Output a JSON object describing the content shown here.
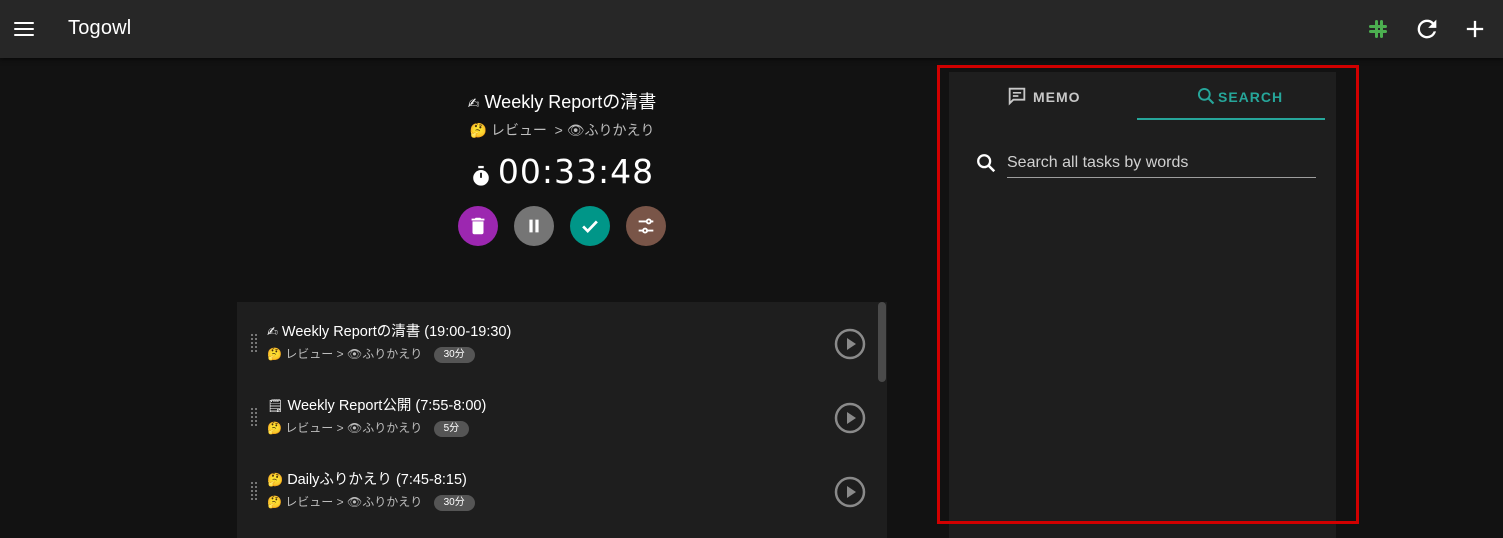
{
  "app": {
    "title": "Togowl"
  },
  "current_task": {
    "emoji": "✍",
    "title": "Weekly Reportの清書",
    "project_emoji": "🤔",
    "project": "レビュー",
    "separator": ">",
    "sub_emoji": "👁",
    "subproject": "ふりかえり",
    "timer": "00:33:48"
  },
  "controls": {
    "delete_color": "#9c27b0",
    "pause_color": "#757575",
    "complete_color": "#009688",
    "adjust_color": "#795548"
  },
  "tasks": [
    {
      "emoji": "✍",
      "title": "Weekly Reportの清書 (19:00-19:30)",
      "project_emoji": "🤔",
      "project": "レビュー",
      "separator": ">",
      "sub_emoji": "👁",
      "subproject": "ふりかえり",
      "estimate": "30分"
    },
    {
      "emoji": "🗒",
      "title": "Weekly Report公開 (7:55-8:00)",
      "project_emoji": "🤔",
      "project": "レビュー",
      "separator": ">",
      "sub_emoji": "👁",
      "subproject": "ふりかえり",
      "estimate": "5分"
    },
    {
      "emoji": "🤔",
      "title": "Dailyふりかえり (7:45-8:15)",
      "project_emoji": "🤔",
      "project": "レビュー",
      "separator": ">",
      "sub_emoji": "👁",
      "subproject": "ふりかえり",
      "estimate": "30分"
    }
  ],
  "panel": {
    "tabs": {
      "memo": "MEMO",
      "search": "SEARCH"
    },
    "active_tab": "search",
    "search_placeholder": "Search all tasks by words",
    "accent": "#26a69a"
  },
  "highlight_color": "#d10000"
}
